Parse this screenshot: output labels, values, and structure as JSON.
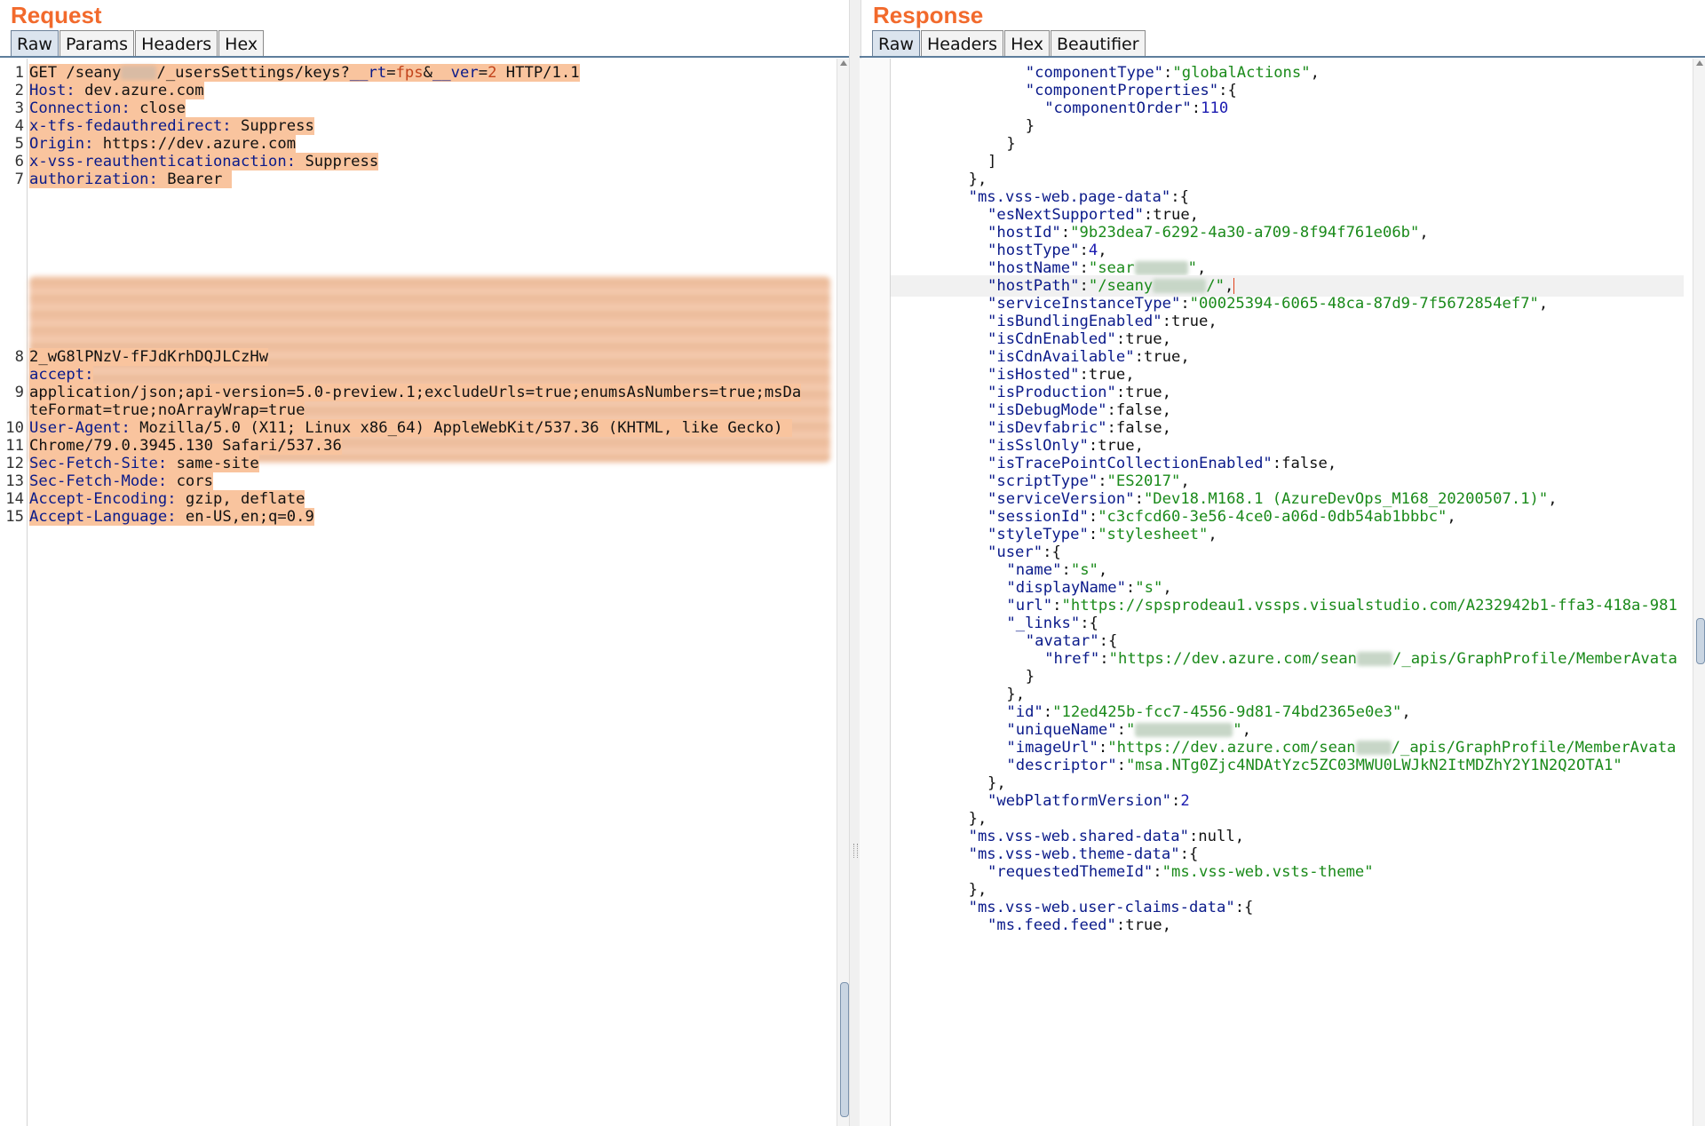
{
  "request": {
    "title": "Request",
    "tabs": [
      "Raw",
      "Params",
      "Headers",
      "Hex"
    ],
    "active_tab": "Raw",
    "line_numbers": [
      "1",
      "2",
      "3",
      "4",
      "5",
      "6",
      "7",
      "8",
      "9",
      "10",
      "11",
      "12",
      "13",
      "14",
      "15"
    ],
    "line1": {
      "method": "GET /seany",
      "path_mid": "/_usersSettings/keys?",
      "p1": "__rt",
      "eq1": "=",
      "v1": "fps",
      "amp": "&",
      "p2": "__ver",
      "eq2": "=",
      "v2": "2",
      "proto": " HTTP/1.1"
    },
    "headers": [
      {
        "key": "Host:",
        "value": " dev.azure.com"
      },
      {
        "key": "Connection:",
        "value": " close"
      },
      {
        "key": "x-tfs-fedauthredirect:",
        "value": " Suppress"
      },
      {
        "key": "Origin:",
        "value": " https://dev.azure.com"
      },
      {
        "key": "x-vss-reauthenticationaction:",
        "value": " Suppress"
      },
      {
        "key": "authorization:",
        "value": " Bearer "
      }
    ],
    "token_tail": "2_wG8lPNzV-fFJdKrhDQJLCzHw",
    "accept_key": "accept:",
    "accept_value_1": "application/json;api-version=5.0-preview.1;excludeUrls=true;enumsAsNumbers=true;msDa",
    "accept_value_2": "teFormat=true;noArrayWrap=true",
    "ua_key": "User-Agent:",
    "ua_value_1": " Mozilla/5.0 (X11; Linux x86_64) AppleWebKit/537.36 (KHTML, like Gecko) ",
    "ua_value_2": "Chrome/79.0.3945.130 Safari/537.36",
    "tail_headers": [
      {
        "key": "Sec-Fetch-Site:",
        "value": " same-site"
      },
      {
        "key": "Sec-Fetch-Mode:",
        "value": " cors"
      },
      {
        "key": "Accept-Encoding:",
        "value": " gzip, deflate"
      },
      {
        "key": "Accept-Language:",
        "value": " en-US,en;q=0.9"
      }
    ]
  },
  "response": {
    "title": "Response",
    "tabs": [
      "Raw",
      "Headers",
      "Hex",
      "Beautifier"
    ],
    "active_tab": "Raw",
    "lines": [
      {
        "indent": 7,
        "parts": [
          [
            "k",
            "\"componentType\""
          ],
          [
            "v",
            ":"
          ],
          [
            "s",
            "\"globalActions\""
          ],
          [
            "v",
            ","
          ]
        ]
      },
      {
        "indent": 7,
        "parts": [
          [
            "k",
            "\"componentProperties\""
          ],
          [
            "v",
            ":{"
          ]
        ]
      },
      {
        "indent": 8,
        "parts": [
          [
            "k",
            "\"componentOrder\""
          ],
          [
            "v",
            ":"
          ],
          [
            "n",
            "110"
          ]
        ]
      },
      {
        "indent": 7,
        "parts": [
          [
            "v",
            "}"
          ]
        ]
      },
      {
        "indent": 6,
        "parts": [
          [
            "v",
            "}"
          ]
        ]
      },
      {
        "indent": 5,
        "parts": [
          [
            "v",
            "]"
          ]
        ]
      },
      {
        "indent": 4,
        "parts": [
          [
            "v",
            "},"
          ]
        ]
      },
      {
        "indent": 4,
        "parts": [
          [
            "k",
            "\"ms.vss-web.page-data\""
          ],
          [
            "v",
            ":{"
          ]
        ]
      },
      {
        "indent": 5,
        "parts": [
          [
            "k",
            "\"esNextSupported\""
          ],
          [
            "v",
            ":true,"
          ]
        ]
      },
      {
        "indent": 5,
        "parts": [
          [
            "k",
            "\"hostId\""
          ],
          [
            "v",
            ":"
          ],
          [
            "s",
            "\"9b23dea7-6292-4a30-a709-8f94f761e06b\""
          ],
          [
            "v",
            ","
          ]
        ]
      },
      {
        "indent": 5,
        "parts": [
          [
            "k",
            "\"hostType\""
          ],
          [
            "v",
            ":"
          ],
          [
            "n",
            "4"
          ],
          [
            "v",
            ","
          ]
        ]
      },
      {
        "indent": 5,
        "parts": [
          [
            "k",
            "\"hostName\""
          ],
          [
            "v",
            ":"
          ],
          [
            "s",
            "\"sear"
          ],
          [
            "redact",
            "60"
          ],
          [
            "s",
            "\""
          ],
          [
            "v",
            ","
          ]
        ]
      },
      {
        "indent": 5,
        "cursor": true,
        "parts": [
          [
            "k",
            "\"hostPath\""
          ],
          [
            "v",
            ":"
          ],
          [
            "s",
            "\"/seany"
          ],
          [
            "redact",
            "60"
          ],
          [
            "s",
            "/\""
          ],
          [
            "v",
            ","
          ],
          [
            "caret",
            ""
          ]
        ]
      },
      {
        "indent": 5,
        "parts": [
          [
            "k",
            "\"serviceInstanceType\""
          ],
          [
            "v",
            ":"
          ],
          [
            "s",
            "\"00025394-6065-48ca-87d9-7f5672854ef7\""
          ],
          [
            "v",
            ","
          ]
        ]
      },
      {
        "indent": 5,
        "parts": [
          [
            "k",
            "\"isBundlingEnabled\""
          ],
          [
            "v",
            ":true,"
          ]
        ]
      },
      {
        "indent": 5,
        "parts": [
          [
            "k",
            "\"isCdnEnabled\""
          ],
          [
            "v",
            ":true,"
          ]
        ]
      },
      {
        "indent": 5,
        "parts": [
          [
            "k",
            "\"isCdnAvailable\""
          ],
          [
            "v",
            ":true,"
          ]
        ]
      },
      {
        "indent": 5,
        "parts": [
          [
            "k",
            "\"isHosted\""
          ],
          [
            "v",
            ":true,"
          ]
        ]
      },
      {
        "indent": 5,
        "parts": [
          [
            "k",
            "\"isProduction\""
          ],
          [
            "v",
            ":true,"
          ]
        ]
      },
      {
        "indent": 5,
        "parts": [
          [
            "k",
            "\"isDebugMode\""
          ],
          [
            "v",
            ":false,"
          ]
        ]
      },
      {
        "indent": 5,
        "parts": [
          [
            "k",
            "\"isDevfabric\""
          ],
          [
            "v",
            ":false,"
          ]
        ]
      },
      {
        "indent": 5,
        "parts": [
          [
            "k",
            "\"isSslOnly\""
          ],
          [
            "v",
            ":true,"
          ]
        ]
      },
      {
        "indent": 5,
        "parts": [
          [
            "k",
            "\"isTracePointCollectionEnabled\""
          ],
          [
            "v",
            ":false,"
          ]
        ]
      },
      {
        "indent": 5,
        "parts": [
          [
            "k",
            "\"scriptType\""
          ],
          [
            "v",
            ":"
          ],
          [
            "s",
            "\"ES2017\""
          ],
          [
            "v",
            ","
          ]
        ]
      },
      {
        "indent": 5,
        "parts": [
          [
            "k",
            "\"serviceVersion\""
          ],
          [
            "v",
            ":"
          ],
          [
            "s",
            "\"Dev18.M168.1 (AzureDevOps_M168_20200507.1)\""
          ],
          [
            "v",
            ","
          ]
        ]
      },
      {
        "indent": 5,
        "parts": [
          [
            "k",
            "\"sessionId\""
          ],
          [
            "v",
            ":"
          ],
          [
            "s",
            "\"c3cfcd60-3e56-4ce0-a06d-0db54ab1bbbc\""
          ],
          [
            "v",
            ","
          ]
        ]
      },
      {
        "indent": 5,
        "parts": [
          [
            "k",
            "\"styleType\""
          ],
          [
            "v",
            ":"
          ],
          [
            "s",
            "\"stylesheet\""
          ],
          [
            "v",
            ","
          ]
        ]
      },
      {
        "indent": 5,
        "parts": [
          [
            "k",
            "\"user\""
          ],
          [
            "v",
            ":{"
          ]
        ]
      },
      {
        "indent": 6,
        "parts": [
          [
            "k",
            "\"name\""
          ],
          [
            "v",
            ":"
          ],
          [
            "s",
            "\"s\""
          ],
          [
            "v",
            ","
          ]
        ]
      },
      {
        "indent": 6,
        "parts": [
          [
            "k",
            "\"displayName\""
          ],
          [
            "v",
            ":"
          ],
          [
            "s",
            "\"s\""
          ],
          [
            "v",
            ","
          ]
        ]
      },
      {
        "indent": 6,
        "parts": [
          [
            "k",
            "\"url\""
          ],
          [
            "v",
            ":"
          ],
          [
            "s",
            "\"https://spsprodeau1.vssps.visualstudio.com/A232942b1-ffa3-418a-981"
          ]
        ]
      },
      {
        "indent": 6,
        "parts": [
          [
            "k",
            "\"_links\""
          ],
          [
            "v",
            ":{"
          ]
        ]
      },
      {
        "indent": 7,
        "parts": [
          [
            "k",
            "\"avatar\""
          ],
          [
            "v",
            ":{"
          ]
        ]
      },
      {
        "indent": 8,
        "parts": [
          [
            "k",
            "\"href\""
          ],
          [
            "v",
            ":"
          ],
          [
            "s",
            "\"https://dev.azure.com/sean"
          ],
          [
            "redact",
            "40"
          ],
          [
            "s",
            "/_apis/GraphProfile/MemberAvata"
          ]
        ]
      },
      {
        "indent": 7,
        "parts": [
          [
            "v",
            "}"
          ]
        ]
      },
      {
        "indent": 6,
        "parts": [
          [
            "v",
            "},"
          ]
        ]
      },
      {
        "indent": 6,
        "parts": [
          [
            "k",
            "\"id\""
          ],
          [
            "v",
            ":"
          ],
          [
            "s",
            "\"12ed425b-fcc7-4556-9d81-74bd2365e0e3\""
          ],
          [
            "v",
            ","
          ]
        ]
      },
      {
        "indent": 6,
        "parts": [
          [
            "k",
            "\"uniqueName\""
          ],
          [
            "v",
            ":"
          ],
          [
            "s",
            "\""
          ],
          [
            "redact",
            "110"
          ],
          [
            "s",
            "\""
          ],
          [
            "v",
            ","
          ]
        ]
      },
      {
        "indent": 6,
        "parts": [
          [
            "k",
            "\"imageUrl\""
          ],
          [
            "v",
            ":"
          ],
          [
            "s",
            "\"https://dev.azure.com/sean"
          ],
          [
            "redact",
            "40"
          ],
          [
            "s",
            "/_apis/GraphProfile/MemberAvata"
          ]
        ]
      },
      {
        "indent": 6,
        "parts": [
          [
            "k",
            "\"descriptor\""
          ],
          [
            "v",
            ":"
          ],
          [
            "s",
            "\"msa.NTg0Zjc4NDAtYzc5ZC03MWU0LWJkN2ItMDZhY2Y1N2Q2OTA1\""
          ]
        ]
      },
      {
        "indent": 5,
        "parts": [
          [
            "v",
            "},"
          ]
        ]
      },
      {
        "indent": 5,
        "parts": [
          [
            "k",
            "\"webPlatformVersion\""
          ],
          [
            "v",
            ":"
          ],
          [
            "n",
            "2"
          ]
        ]
      },
      {
        "indent": 4,
        "parts": [
          [
            "v",
            "},"
          ]
        ]
      },
      {
        "indent": 4,
        "parts": [
          [
            "k",
            "\"ms.vss-web.shared-data\""
          ],
          [
            "v",
            ":null,"
          ]
        ]
      },
      {
        "indent": 4,
        "parts": [
          [
            "k",
            "\"ms.vss-web.theme-data\""
          ],
          [
            "v",
            ":{"
          ]
        ]
      },
      {
        "indent": 5,
        "parts": [
          [
            "k",
            "\"requestedThemeId\""
          ],
          [
            "v",
            ":"
          ],
          [
            "s",
            "\"ms.vss-web.vsts-theme\""
          ]
        ]
      },
      {
        "indent": 4,
        "parts": [
          [
            "v",
            "},"
          ]
        ]
      },
      {
        "indent": 4,
        "parts": [
          [
            "k",
            "\"ms.vss-web.user-claims-data\""
          ],
          [
            "v",
            ":{"
          ]
        ]
      },
      {
        "indent": 5,
        "parts": [
          [
            "k",
            "\"ms.feed.feed\""
          ],
          [
            "v",
            ":true,"
          ]
        ]
      }
    ]
  }
}
